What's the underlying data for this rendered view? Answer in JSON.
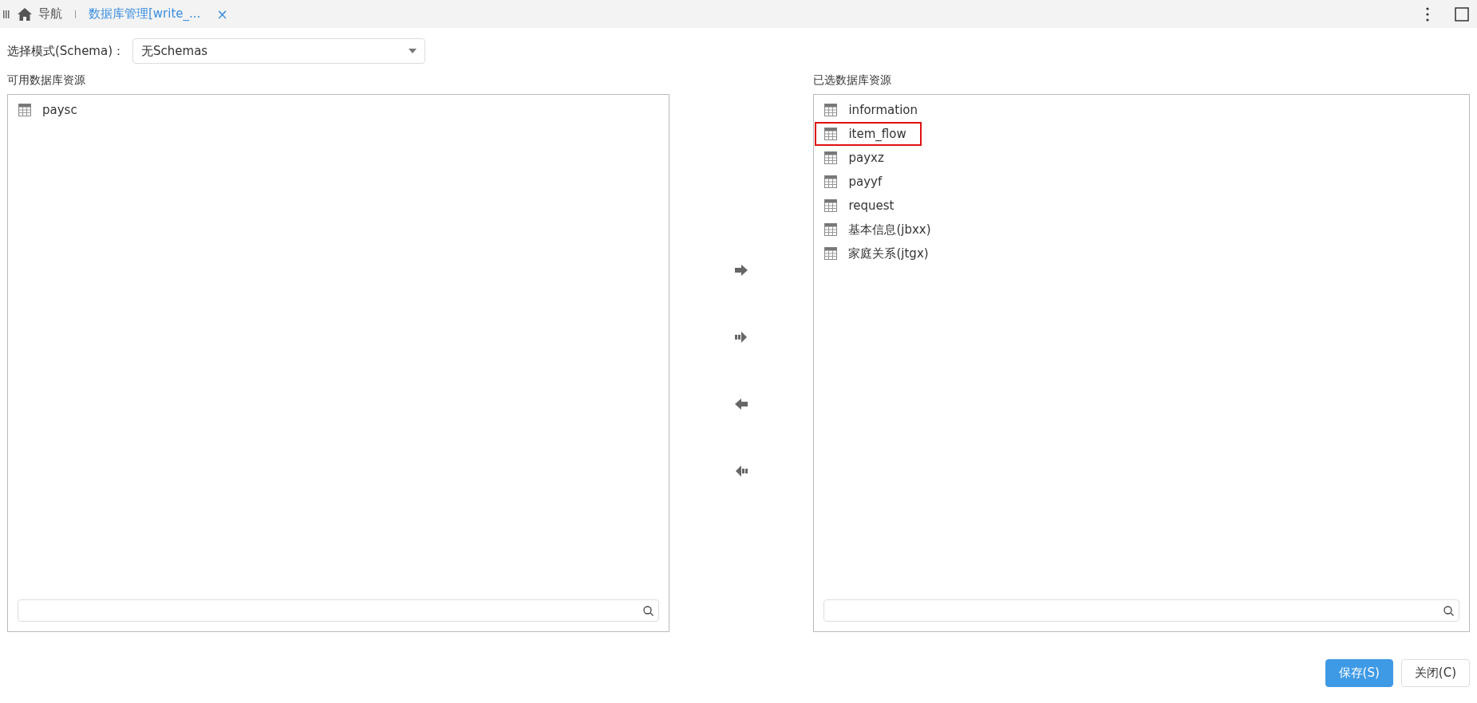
{
  "tabs": [
    {
      "label": "导航",
      "kind": "home",
      "selected": false
    },
    {
      "label": "数据库管理[write_...",
      "kind": "page",
      "selected": true,
      "close": "×"
    }
  ],
  "schema": {
    "label": "选择模式(Schema)：",
    "value": "无Schemas"
  },
  "available": {
    "title": "可用数据库资源",
    "items": [
      {
        "label": "paysc",
        "selected": false
      }
    ]
  },
  "chosen": {
    "title": "已选数据库资源",
    "items": [
      {
        "label": "information",
        "selected": false
      },
      {
        "label": "item_flow",
        "selected": true
      },
      {
        "label": "payxz",
        "selected": false
      },
      {
        "label": "payyf",
        "selected": false
      },
      {
        "label": "request",
        "selected": false
      },
      {
        "label": "基本信息(jbxx)",
        "selected": false
      },
      {
        "label": "家庭关系(jtgx)",
        "selected": false
      }
    ]
  },
  "buttons": [
    {
      "label": "保存(S)",
      "kind": "primary"
    },
    {
      "label": "关闭(C)",
      "kind": "default"
    }
  ]
}
